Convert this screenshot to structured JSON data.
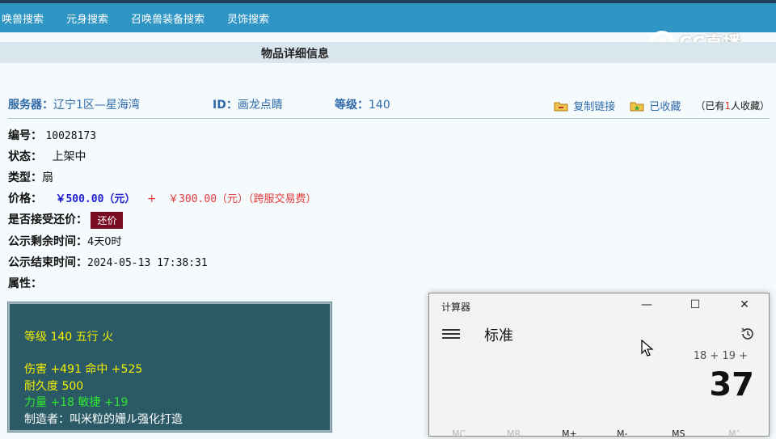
{
  "nav": {
    "items": [
      "唤兽搜索",
      "元身搜索",
      "召唤兽装备搜索",
      "灵饰搜索"
    ]
  },
  "watermark": {
    "text": "CC直播"
  },
  "header": {
    "title": "物品详细信息"
  },
  "server_row": {
    "server_label": "服务器：",
    "server_value": "辽宁1区—星海湾",
    "id_label": "ID：",
    "id_value": "画龙点睛",
    "level_label": "等级：",
    "level_value": "140",
    "copy_link": "复制链接",
    "favorited": "已收藏",
    "fav_prefix": "（已有",
    "fav_count": "1",
    "fav_suffix": "人收藏）"
  },
  "info": {
    "serial_label": "编号：",
    "serial_value": "10028173",
    "status_label": "状态：",
    "status_value": "上架中",
    "type_label": "类型：",
    "type_value": "扇",
    "price_label": "价格：",
    "price_value": "￥500.00（元）",
    "price_plus": "+",
    "price_fee": "￥300.00（元）（跨服交易费）",
    "bargain_label": "是否接受还价：",
    "bargain_button": "还价",
    "remain_label": "公示剩余时间：",
    "remain_value": "4天0时",
    "end_label": "公示结束时间：",
    "end_value": "2024-05-13 17:38:31",
    "attr_label": "属性："
  },
  "attributes": {
    "line1": "等级 140 五行 火",
    "line2": "伤害 +491 命中 +525",
    "line3": "耐久度 500",
    "line4": "力量 +18 敏捷 +19",
    "line5": "制造者：叫米粒的姗ル强化打造"
  },
  "calculator": {
    "caption": "计算器",
    "minimize": "—",
    "maximize": "☐",
    "close": "✕",
    "mode": "标准",
    "expression": "18 + 19 +",
    "result": "37",
    "memory": [
      "MC",
      "MR",
      "M+",
      "M-",
      "MS",
      "M˅"
    ]
  },
  "colors": {
    "nav_bg": "#2e95c4",
    "link_blue": "#2f6aa8",
    "price_blue": "#2020d0",
    "fee_red": "#e23b3b",
    "bargain_bg": "#7a0c22",
    "attr_bg": "#2b5a66"
  }
}
